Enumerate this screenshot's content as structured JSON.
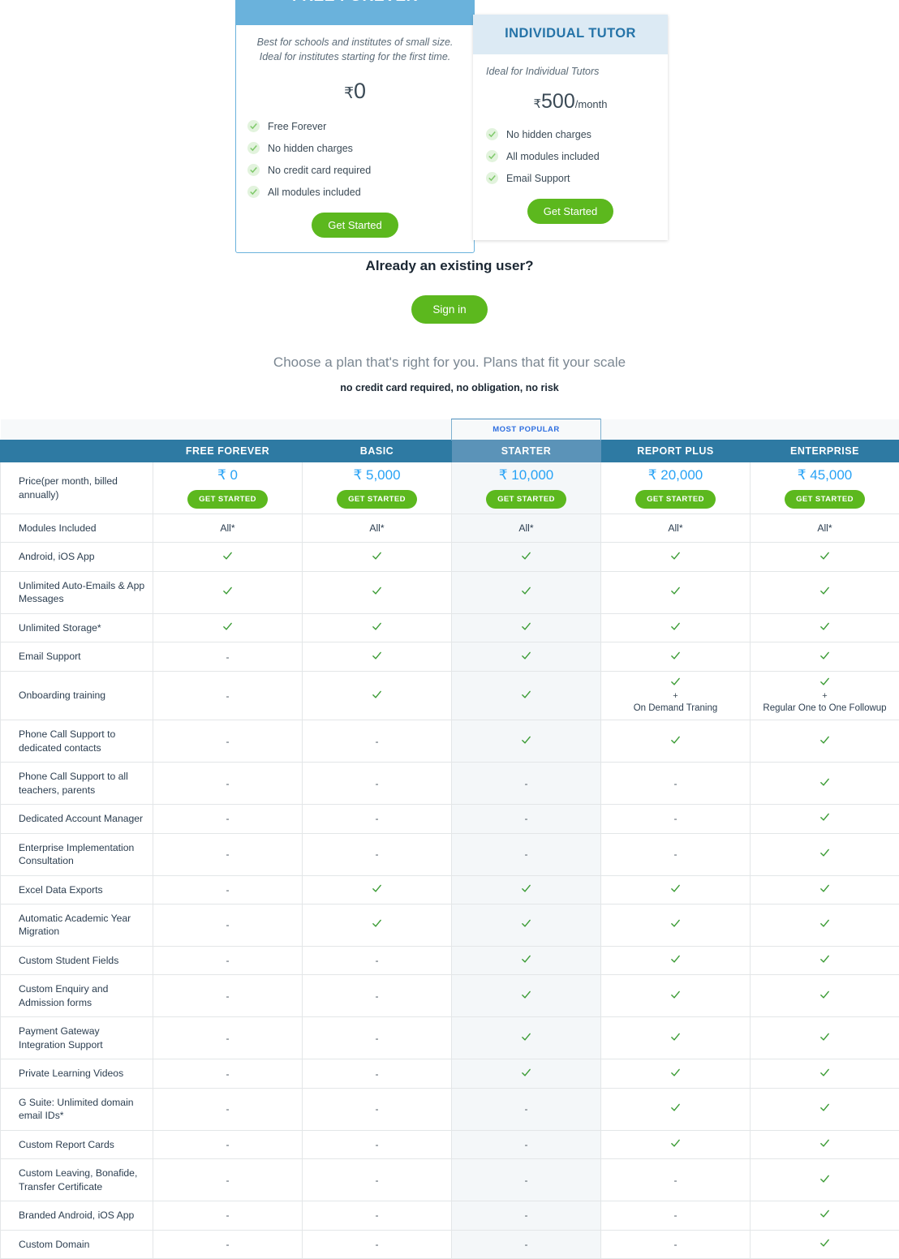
{
  "cards": {
    "free": {
      "title": "FREE FOREVER",
      "description": "Best for schools and institutes of small size. Ideal for institutes starting for the first time.",
      "currency": "₹",
      "price": "0",
      "features": [
        "Free Forever",
        "No hidden charges",
        "No credit card required",
        "All modules included"
      ],
      "cta": "Get Started"
    },
    "tutor": {
      "title": "INDIVIDUAL TUTOR",
      "description": "Ideal for Individual Tutors",
      "currency": "₹",
      "price": "500",
      "period": "/month",
      "features": [
        "No hidden charges",
        "All modules included",
        "Email Support"
      ],
      "cta": "Get Started"
    }
  },
  "mid": {
    "heading": "Already an existing user?",
    "signin_label": "Sign in",
    "subheading": "Choose a plan that's right for you. Plans that fit your scale",
    "note": "no credit card required, no obligation, no risk"
  },
  "table": {
    "most_popular_label": "MOST POPULAR",
    "popular_column_index": 2,
    "feature_col_header": "",
    "plans": [
      "FREE FOREVER",
      "BASIC",
      "STARTER",
      "REPORT PLUS",
      "ENTERPRISE"
    ],
    "price_row_label": "Price(per month, billed annually)",
    "prices": [
      "₹ 0",
      "₹ 5,000",
      "₹ 10,000",
      "₹ 20,000",
      "₹ 45,000"
    ],
    "cta_label": "GET STARTED",
    "rows": [
      {
        "label": "Modules Included",
        "values": [
          "All*",
          "All*",
          "All*",
          "All*",
          "All*"
        ]
      },
      {
        "label": "Android, iOS App",
        "values": [
          "yes",
          "yes",
          "yes",
          "yes",
          "yes"
        ]
      },
      {
        "label": "Unlimited Auto-Emails & App Messages",
        "values": [
          "yes",
          "yes",
          "yes",
          "yes",
          "yes"
        ]
      },
      {
        "label": "Unlimited Storage*",
        "values": [
          "yes",
          "yes",
          "yes",
          "yes",
          "yes"
        ]
      },
      {
        "label": "Email Support",
        "values": [
          "-",
          "yes",
          "yes",
          "yes",
          "yes"
        ]
      },
      {
        "label": "Onboarding training",
        "values": [
          "-",
          "yes",
          "yes",
          "yes+On Demand Traning",
          "yes+Regular One to One Followup"
        ]
      },
      {
        "label": "Phone Call Support to dedicated contacts",
        "values": [
          "-",
          "-",
          "yes",
          "yes",
          "yes"
        ]
      },
      {
        "label": "Phone Call Support to all teachers, parents",
        "values": [
          "-",
          "-",
          "-",
          "-",
          "yes"
        ]
      },
      {
        "label": "Dedicated Account Manager",
        "values": [
          "-",
          "-",
          "-",
          "-",
          "yes"
        ]
      },
      {
        "label": "Enterprise Implementation Consultation",
        "values": [
          "-",
          "-",
          "-",
          "-",
          "yes"
        ]
      },
      {
        "label": "Excel Data Exports",
        "values": [
          "-",
          "yes",
          "yes",
          "yes",
          "yes"
        ]
      },
      {
        "label": "Automatic Academic Year Migration",
        "values": [
          "-",
          "yes",
          "yes",
          "yes",
          "yes"
        ]
      },
      {
        "label": "Custom Student Fields",
        "values": [
          "-",
          "-",
          "yes",
          "yes",
          "yes"
        ]
      },
      {
        "label": "Custom Enquiry and Admission forms",
        "values": [
          "-",
          "-",
          "yes",
          "yes",
          "yes"
        ]
      },
      {
        "label": "Payment Gateway Integration Support",
        "values": [
          "-",
          "-",
          "yes",
          "yes",
          "yes"
        ]
      },
      {
        "label": "Private Learning Videos",
        "values": [
          "-",
          "-",
          "yes",
          "yes",
          "yes"
        ]
      },
      {
        "label": "G Suite: Unlimited domain email IDs*",
        "values": [
          "-",
          "-",
          "-",
          "yes",
          "yes"
        ]
      },
      {
        "label": "Custom Report Cards",
        "values": [
          "-",
          "-",
          "-",
          "yes",
          "yes"
        ]
      },
      {
        "label": "Custom Leaving, Bonafide, Transfer Certificate",
        "values": [
          "-",
          "-",
          "-",
          "-",
          "yes"
        ]
      },
      {
        "label": "Branded Android, iOS App",
        "values": [
          "-",
          "-",
          "-",
          "-",
          "yes"
        ]
      },
      {
        "label": "Custom Domain",
        "values": [
          "-",
          "-",
          "-",
          "-",
          "yes"
        ]
      }
    ],
    "extra_notes": {
      "report_plus_onboarding": "On Demand Traning",
      "enterprise_onboarding": "Regular One to One Followup",
      "plus_symbol": "+"
    }
  },
  "colors": {
    "card_free_header": "#6ab2dc",
    "card_tutor_header": "#dceaf4",
    "card_tutor_title": "#2674a8",
    "table_header": "#2e7aa3",
    "table_header_highlight": "#5b93b8",
    "green_button": "#5cb81e",
    "price_blue": "#29a3f5",
    "most_popular_text": "#2f6fe0"
  }
}
